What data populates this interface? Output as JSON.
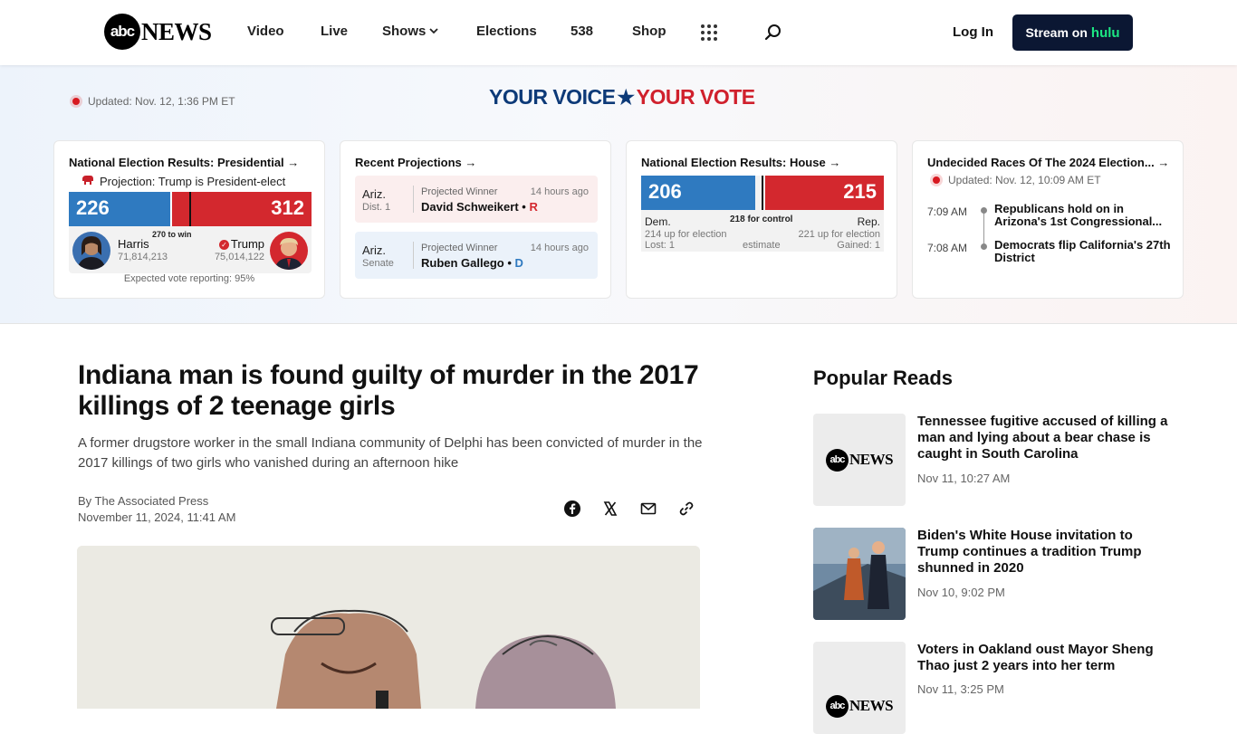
{
  "nav": {
    "logo_abc": "abc",
    "logo_news": "NEWS",
    "items": [
      "Video",
      "Live",
      "Shows",
      "Elections",
      "538",
      "Shop"
    ],
    "login": "Log In",
    "stream_label": "Stream on",
    "stream_brand": "hulu"
  },
  "election": {
    "updated": "Updated: Nov. 12, 1:36 PM ET",
    "banner_left": "YOUR VOICE",
    "banner_right": "YOUR VOTE",
    "presidential": {
      "title": "National Election Results: Presidential →",
      "projection": "Projection: Trump is President-elect",
      "dem_ev": "226",
      "rep_ev": "312",
      "dem_ev_value": 226,
      "rep_ev_value": 312,
      "to_win": "270 to win",
      "dem_name": "Harris",
      "dem_votes": "71,814,213",
      "rep_name": "Trump",
      "rep_votes": "75,014,122",
      "expected": "Expected vote reporting: 95%"
    },
    "projections": {
      "title": "Recent Projections →",
      "items": [
        {
          "state": "Ariz.",
          "race": "Dist. 1",
          "label": "Projected Winner",
          "time": "14 hours ago",
          "winner": "David Schweikert",
          "party": "R"
        },
        {
          "state": "Ariz.",
          "race": "Senate",
          "label": "Projected Winner",
          "time": "14 hours ago",
          "winner": "Ruben Gallego",
          "party": "D"
        }
      ]
    },
    "house": {
      "title": "National Election Results: House →",
      "dem": "206",
      "rep": "215",
      "dem_value": 206,
      "rep_value": 215,
      "control": "218 for control",
      "dem_label": "Dem.",
      "rep_label": "Rep.",
      "dem_up": "214 up for election",
      "rep_up": "221 up for election",
      "dem_change": "Lost: 1",
      "rep_change": "Gained: 1",
      "estimate": "estimate"
    },
    "undecided": {
      "title": "Undecided Races Of The 2024 Election...",
      "updated": "Updated: Nov. 12, 10:09 AM ET",
      "items": [
        {
          "time": "7:09 AM",
          "text": "Republicans hold on in Arizona's 1st Congressional..."
        },
        {
          "time": "7:08 AM",
          "text": "Democrats flip California's 27th District"
        }
      ]
    }
  },
  "article": {
    "headline": "Indiana man is found guilty of murder in the 2017 killings of 2 teenage girls",
    "dek": "A former drugstore worker in the small Indiana community of Delphi has been convicted of murder in the 2017 killings of two girls who vanished during an afternoon hike",
    "byline": "By The Associated Press",
    "date": "November 11, 2024, 11:41 AM"
  },
  "sidebar": {
    "title": "Popular Reads",
    "items": [
      {
        "headline": "Tennessee fugitive accused of killing a man and lying about a bear chase is caught in South Carolina",
        "date": "Nov 11, 10:27 AM"
      },
      {
        "headline": "Biden's White House invitation to Trump continues a tradition Trump shunned in 2020",
        "date": "Nov 10, 9:02 PM"
      },
      {
        "headline": "Voters in Oakland oust Mayor Sheng Thao just 2 years into her term",
        "date": "Nov 11, 3:25 PM"
      }
    ]
  },
  "colors": {
    "dem": "#2f7ac0",
    "rep": "#d3282e",
    "hulu_bg": "#0b1733",
    "hulu_green": "#1ce783"
  },
  "icons": [
    "shows-chevron-icon",
    "apps-grid-icon",
    "search-icon",
    "live-dot-icon",
    "republican-elephant-icon",
    "winner-check-icon",
    "facebook-icon",
    "x-icon",
    "email-icon",
    "link-icon"
  ]
}
